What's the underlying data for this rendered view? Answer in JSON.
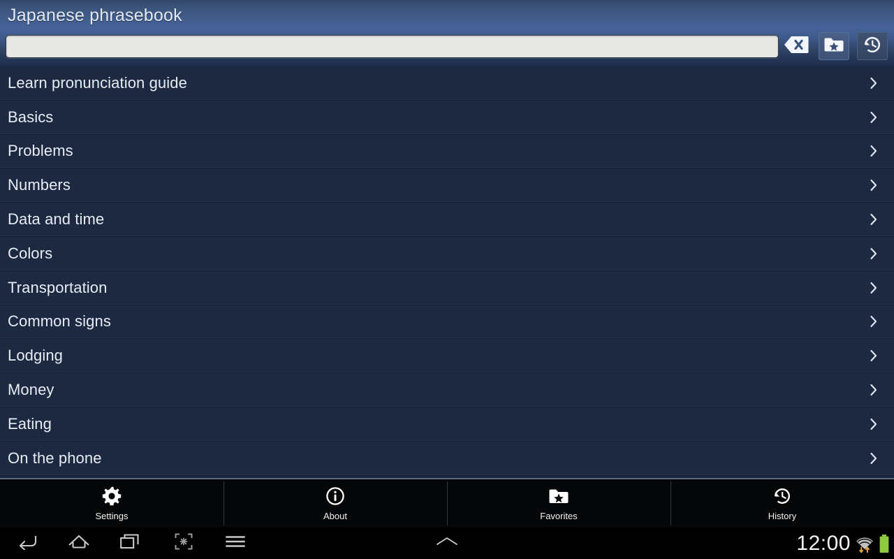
{
  "header": {
    "title": "Japanese phrasebook",
    "search": {
      "value": "",
      "placeholder": ""
    },
    "buttons": [
      {
        "name": "clear-button",
        "icon": "backspace-icon",
        "label": "Clear"
      },
      {
        "name": "favorites-button",
        "icon": "star-folder-icon",
        "label": "Favorites"
      },
      {
        "name": "history-button",
        "icon": "history-clock-icon",
        "label": "History"
      }
    ]
  },
  "list": {
    "chevron_icon": "chevron-right-icon",
    "items": [
      {
        "label": "Learn pronunciation guide"
      },
      {
        "label": "Basics"
      },
      {
        "label": "Problems"
      },
      {
        "label": "Numbers"
      },
      {
        "label": "Data and time"
      },
      {
        "label": "Colors"
      },
      {
        "label": "Transportation"
      },
      {
        "label": "Common signs"
      },
      {
        "label": "Lodging"
      },
      {
        "label": "Money"
      },
      {
        "label": "Eating"
      },
      {
        "label": "On the phone"
      }
    ]
  },
  "tabbar": {
    "tabs": [
      {
        "label": "Settings",
        "icon": "gear-icon"
      },
      {
        "label": "About",
        "icon": "info-icon"
      },
      {
        "label": "Favorites",
        "icon": "star-folder-icon"
      },
      {
        "label": "History",
        "icon": "history-clock-icon"
      }
    ]
  },
  "navbar": {
    "buttons": [
      {
        "name": "back",
        "icon": "back-arrow-icon"
      },
      {
        "name": "home",
        "icon": "home-icon"
      },
      {
        "name": "recents",
        "icon": "recent-apps-icon"
      },
      {
        "name": "capture",
        "icon": "screenshot-icon"
      },
      {
        "name": "menu",
        "icon": "menu-icon"
      },
      {
        "name": "expand",
        "icon": "chevron-up-icon"
      }
    ],
    "status": {
      "clock": "12:00",
      "wifi_icon": "wifi-activity-icon",
      "battery_icon": "battery-full-icon",
      "battery_color": "#8fcb3f",
      "activity_color": "#e8a33d"
    }
  },
  "colors": {
    "header_accent": "#46639a",
    "list_background": "#1c2941",
    "text": "#e7edf5",
    "navbar_background": "#000000"
  }
}
